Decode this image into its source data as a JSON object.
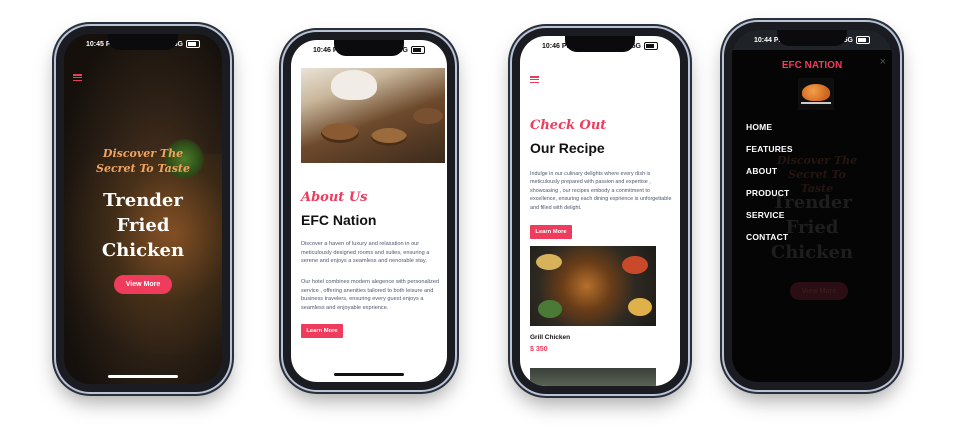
{
  "phone1": {
    "time": "10:45 PM",
    "network": "5G",
    "tagline": "Discover The Secret To Taste",
    "heading": "Trender Fried Chicken",
    "button": "View More",
    "colors": {
      "accent": "#ef3b5c",
      "tagline": "#f2a35e"
    }
  },
  "phone2": {
    "time": "10:46 PM",
    "network": "5G",
    "section_label": "About Us",
    "title": "EFC Nation",
    "para1": "Discover a haven of luxury and relaxation in our meticulously designed rooms and suites, ensuring a serene and enjoys a seamless and nenorable stay.",
    "para2": "Our hotel combines modern alegence with personalized service , offering anenities tailored to both leisure and business travelers, ensuring every guest enjoys a seamless and enjoyable exprience.",
    "button": "Learn More"
  },
  "phone3": {
    "time": "10:46 PM",
    "network": "5G",
    "section_label": "Check Out",
    "title": "Our Recipe",
    "para": "Indulge in our culinary delights where every dish is meticulously prepared with passion and expertise , showcasing , our recipes embody a conmitment to excellence, ensuring each dining exprience is unforgettable and filled with delight.",
    "button": "Learn More",
    "item_name": "Grill Chicken",
    "item_price": "$ 350"
  },
  "phone4": {
    "time": "10:44 PM",
    "network": "5G",
    "brand": "EFC NATION",
    "close": "×",
    "menu": [
      "HOME",
      "FEATURES",
      "ABOUT",
      "PRODUCT",
      "SERVICE",
      "CONTACT"
    ],
    "ghost_tagline": "Discover The Secret To Taste",
    "ghost_heading": "Trender Fried Chicken",
    "ghost_button": "View More"
  }
}
